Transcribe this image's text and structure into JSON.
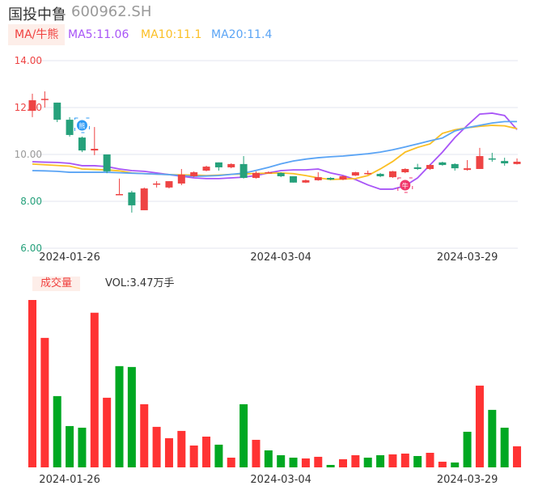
{
  "header": {
    "name": "国投中鲁",
    "code": "600962.SH"
  },
  "legend": {
    "tag": "MA/牛熊",
    "ma5": "MA5:11.06",
    "ma10": "MA10:11.1",
    "ma20": "MA20:11.4"
  },
  "volume_header": {
    "tag": "成交量",
    "value": "VOL:3.47万手"
  },
  "colors": {
    "up": "#ee4444",
    "down": "#26a17b",
    "vol_up": "#ff3333",
    "vol_down": "#00a822",
    "ma5": "#a855f7",
    "ma10": "#fbbf24",
    "ma20": "#5aa4f5"
  },
  "chart_data": [
    {
      "type": "candlestick",
      "ylim": [
        6,
        14
      ],
      "y_ticks": [
        "14.00",
        "12.00",
        "10.00",
        "8.00",
        "6.00"
      ],
      "x_labels": [
        {
          "index": 3,
          "label": "2024-01-26"
        },
        {
          "index": 20,
          "label": "2024-03-04"
        },
        {
          "index": 35,
          "label": "2024-03-29"
        }
      ],
      "ohlc": [
        [
          11.86,
          12.31,
          12.59,
          11.59
        ],
        [
          12.34,
          12.37,
          12.69,
          12.0
        ],
        [
          12.21,
          11.48,
          12.21,
          11.38
        ],
        [
          11.48,
          10.83,
          11.59,
          10.76
        ],
        [
          10.72,
          10.17,
          10.76,
          10.1
        ],
        [
          10.17,
          10.24,
          11.17,
          9.97
        ],
        [
          10.0,
          9.28,
          10.0,
          9.2
        ],
        [
          8.28,
          8.31,
          8.97,
          8.26
        ],
        [
          8.38,
          7.83,
          8.45,
          7.52
        ],
        [
          7.62,
          8.55,
          8.59,
          7.62
        ],
        [
          8.72,
          8.76,
          8.86,
          8.59
        ],
        [
          8.59,
          8.86,
          8.86,
          8.55
        ],
        [
          8.76,
          9.14,
          9.38,
          8.69
        ],
        [
          9.07,
          9.24,
          9.28,
          9.03
        ],
        [
          9.31,
          9.48,
          9.52,
          9.28
        ],
        [
          9.66,
          9.45,
          9.66,
          9.31
        ],
        [
          9.45,
          9.59,
          9.62,
          9.41
        ],
        [
          9.59,
          9.0,
          9.93,
          8.97
        ],
        [
          9.0,
          9.21,
          9.28,
          8.97
        ],
        [
          9.22,
          9.24,
          9.28,
          9.2
        ],
        [
          9.21,
          9.07,
          9.24,
          9.03
        ],
        [
          9.07,
          8.8,
          9.07,
          8.8
        ],
        [
          8.8,
          8.9,
          8.93,
          8.78
        ],
        [
          8.9,
          9.03,
          9.24,
          8.88
        ],
        [
          9.0,
          8.93,
          9.03,
          8.9
        ],
        [
          8.93,
          9.07,
          9.1,
          8.9
        ],
        [
          9.1,
          9.24,
          9.26,
          9.08
        ],
        [
          9.2,
          9.21,
          9.31,
          9.14
        ],
        [
          9.17,
          9.07,
          9.21,
          9.03
        ],
        [
          9.03,
          9.28,
          9.3,
          9.0
        ],
        [
          9.24,
          9.38,
          9.41,
          9.2
        ],
        [
          9.45,
          9.38,
          9.6,
          9.34
        ],
        [
          9.38,
          9.55,
          9.58,
          9.34
        ],
        [
          9.66,
          9.55,
          9.69,
          9.52
        ],
        [
          9.59,
          9.41,
          9.62,
          9.31
        ],
        [
          9.34,
          9.41,
          9.76,
          9.31
        ],
        [
          9.38,
          9.93,
          10.28,
          9.38
        ],
        [
          9.83,
          9.79,
          10.07,
          9.69
        ],
        [
          9.72,
          9.62,
          9.86,
          9.52
        ],
        [
          9.59,
          9.69,
          9.83,
          9.57
        ]
      ],
      "ma5": [
        9.69,
        9.67,
        9.66,
        9.62,
        9.52,
        9.52,
        9.48,
        9.38,
        9.31,
        9.28,
        9.21,
        9.14,
        9.07,
        9.0,
        8.97,
        8.97,
        9.0,
        9.03,
        9.1,
        9.21,
        9.31,
        9.34,
        9.34,
        9.38,
        9.21,
        9.1,
        8.93,
        8.7,
        8.52,
        8.52,
        8.66,
        9.0,
        9.55,
        10.1,
        10.72,
        11.24,
        11.72,
        11.76,
        11.66,
        11.06
      ],
      "ma10": [
        9.59,
        9.56,
        9.53,
        9.5,
        9.38,
        9.36,
        9.34,
        9.3,
        9.21,
        9.18,
        9.16,
        9.14,
        9.13,
        9.12,
        9.1,
        9.12,
        9.15,
        9.17,
        9.19,
        9.2,
        9.21,
        9.18,
        9.1,
        9.0,
        8.93,
        8.95,
        8.97,
        9.1,
        9.38,
        9.7,
        10.1,
        10.3,
        10.45,
        10.9,
        11.05,
        11.14,
        11.2,
        11.24,
        11.22,
        11.1
      ],
      "ma20": [
        9.31,
        9.3,
        9.28,
        9.24,
        9.24,
        9.24,
        9.24,
        9.22,
        9.2,
        9.18,
        9.16,
        9.14,
        9.1,
        9.07,
        9.08,
        9.1,
        9.15,
        9.2,
        9.32,
        9.45,
        9.6,
        9.72,
        9.8,
        9.86,
        9.9,
        9.93,
        9.98,
        10.03,
        10.1,
        10.2,
        10.32,
        10.45,
        10.58,
        10.7,
        11.0,
        11.14,
        11.24,
        11.34,
        11.4,
        11.4
      ],
      "signals": [
        {
          "index": 4,
          "type": "bear",
          "label": "熊"
        },
        {
          "index": 30,
          "type": "bull",
          "label": "牛"
        }
      ]
    },
    {
      "type": "bar",
      "ylabel": "成交量 (万手)",
      "values": [
        27.6,
        21.35,
        11.75,
        6.81,
        6.54,
        25.5,
        11.48,
        16.69,
        16.55,
        10.41,
        6.68,
        4.81,
        6.01,
        3.6,
        5.07,
        3.74,
        1.6,
        10.41,
        4.54,
        2.8,
        2.0,
        1.6,
        1.47,
        1.74,
        0.4,
        1.34,
        2.0,
        1.6,
        2.0,
        2.14,
        2.27,
        1.87,
        2.4,
        0.93,
        0.8,
        5.87,
        13.48,
        9.48,
        6.54,
        3.47
      ],
      "up": [
        1,
        1,
        0,
        0,
        0,
        1,
        1,
        0,
        0,
        1,
        1,
        1,
        1,
        1,
        1,
        0,
        1,
        0,
        1,
        0,
        0,
        0,
        1,
        1,
        0,
        1,
        1,
        0,
        0,
        1,
        1,
        0,
        1,
        1,
        0,
        0,
        1,
        0,
        0,
        1
      ]
    }
  ]
}
